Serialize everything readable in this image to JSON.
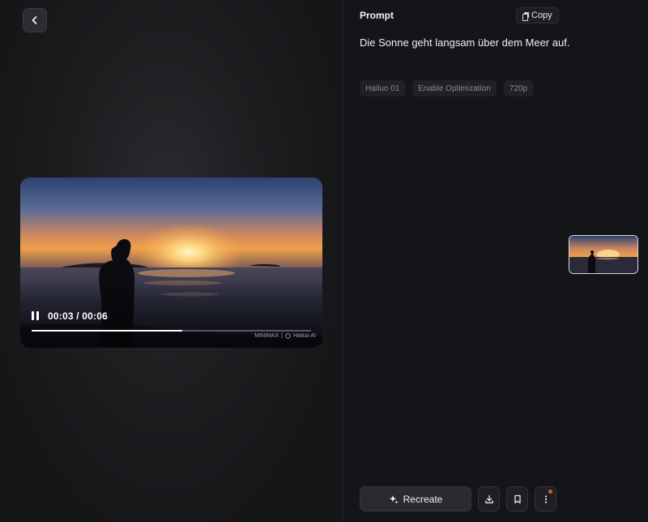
{
  "player": {
    "current_time": "00:03",
    "duration": "00:06",
    "time_text": "00:03 / 00:06",
    "progress_fraction": 0.54,
    "watermark_left": "MINIMAX",
    "watermark_sep": "|",
    "watermark_right": "Hailuo AI"
  },
  "prompt": {
    "title": "Prompt",
    "copy_label": "Copy",
    "text": "Die Sonne geht langsam über dem Meer auf.",
    "tags": [
      "Hailuo 01",
      "Enable Optimization",
      "720p"
    ]
  },
  "actions": {
    "recreate_label": "Recreate"
  },
  "icons": {
    "back": "chevron-left-icon",
    "pause": "pause-icon",
    "copy": "copy-icon",
    "sparkle": "sparkle-icon",
    "download": "download-icon",
    "bookmark": "bookmark-icon",
    "more": "more-vertical-icon"
  },
  "colors": {
    "background": "#141518",
    "notification_dot": "#e2572c",
    "tag_text": "#8a8b91"
  }
}
